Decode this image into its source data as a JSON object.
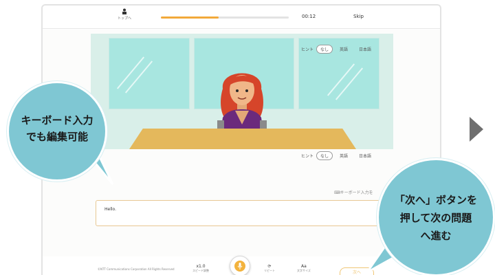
{
  "app": {
    "home_label": "トップへ",
    "progress_fraction": 0.45,
    "timer": "00:12",
    "skip_label": "Skip"
  },
  "hints_top": {
    "label": "ヒント",
    "options": [
      "なし",
      "英語",
      "日本語"
    ],
    "selected": "なし"
  },
  "hints_bottom": {
    "label": "ヒント",
    "options": [
      "なし",
      "英語",
      "日本語"
    ],
    "selected": "なし"
  },
  "answer": {
    "keyboard_link": "⌨キーボード入力を",
    "text": "Hello."
  },
  "bottom": {
    "copyright": "©NTT Communications Corporation All Rights Reserved",
    "speed_label": "x1.0",
    "speed_caption": "スピード調整",
    "repeat_caption": "リピート",
    "font_label": "Aa",
    "font_caption": "文字サイズ",
    "next_label": "次へ"
  },
  "callouts": {
    "left_line1": "キーボード入力",
    "left_line2": "でも編集可能",
    "right_line1": "「次へ」ボタンを",
    "right_line2": "押して次の問題",
    "right_line3": "へ進む"
  },
  "colors": {
    "accent": "#f3b33d",
    "bubble": "#7fc7d3",
    "window": "#a8e6e0",
    "desk": "#e4b85c",
    "arrow": "#6f6f6f"
  }
}
